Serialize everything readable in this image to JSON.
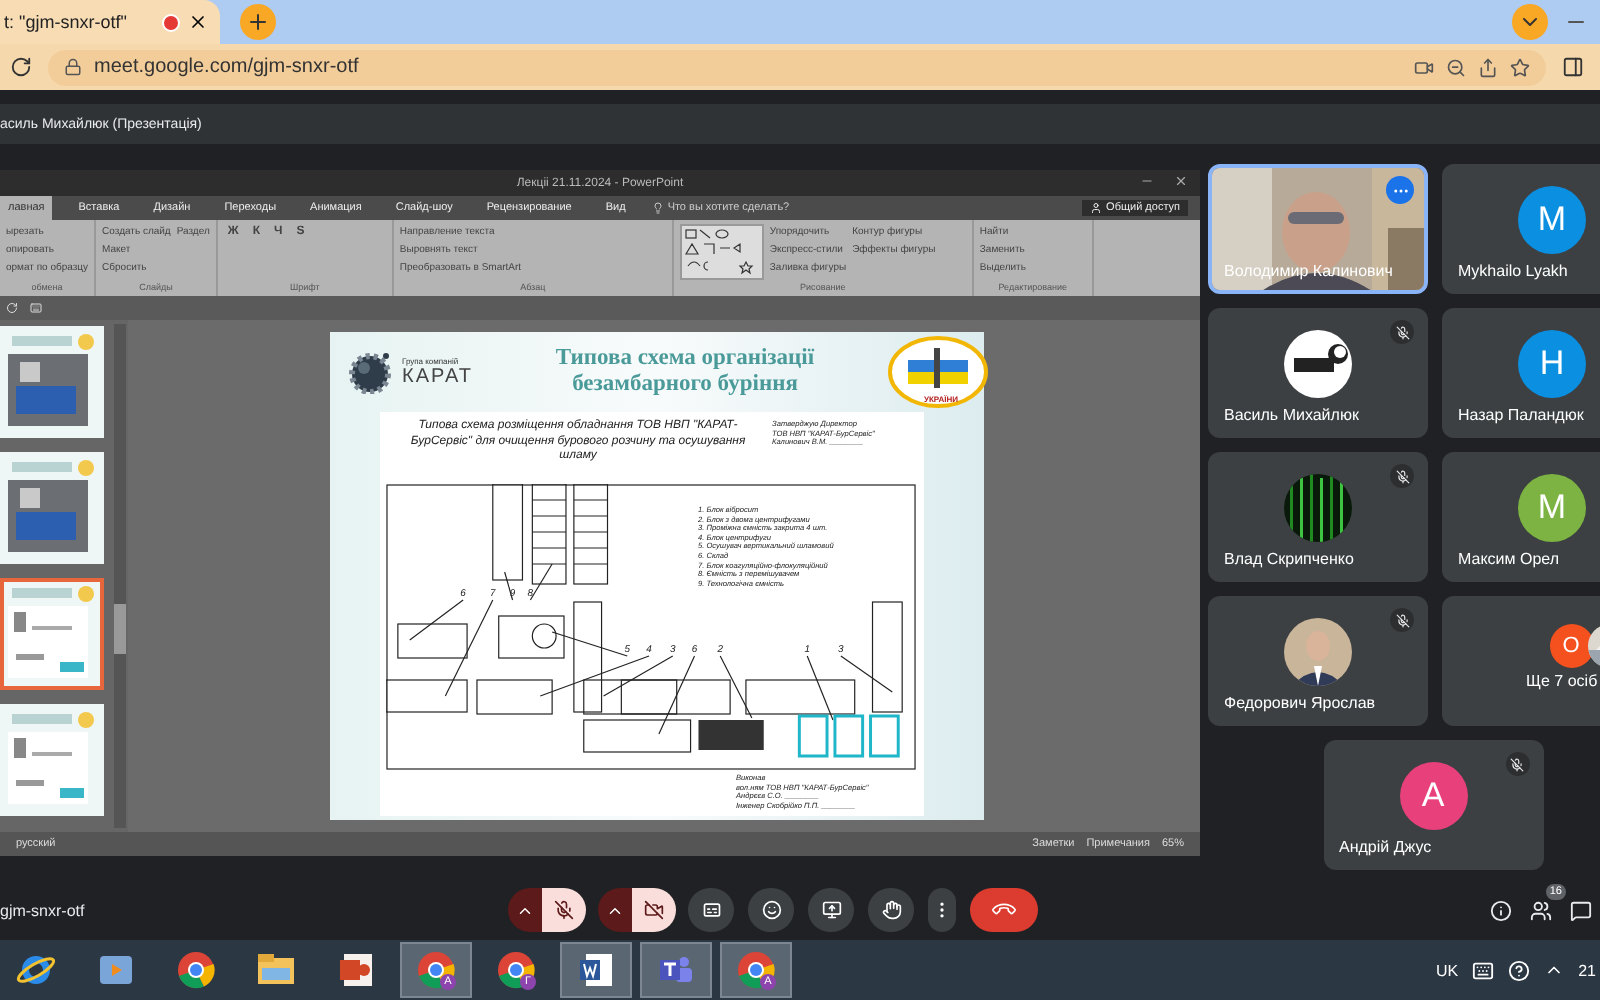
{
  "browser": {
    "tab_title": "t: \"gjm-snxr-otf\"",
    "url": "meet.google.com/gjm-snxr-otf"
  },
  "meet": {
    "presenter_label": "асиль Михайлюк (Презентація)",
    "meeting_code": "gjm-snxr-otf",
    "participant_count": "16",
    "mic_on": false,
    "camera_on": false
  },
  "presentation": {
    "window_title": "Лекціі 21.11.2024 - PowerPoint",
    "ribbon_tabs": [
      {
        "label": "лавная",
        "selected": true
      },
      {
        "label": "Вставка",
        "selected": false
      },
      {
        "label": "Дизайн",
        "selected": false
      },
      {
        "label": "Переходы",
        "selected": false
      },
      {
        "label": "Анимация",
        "selected": false
      },
      {
        "label": "Слайд-шоу",
        "selected": false
      },
      {
        "label": "Рецензирование",
        "selected": false
      },
      {
        "label": "Вид",
        "selected": false
      }
    ],
    "tell_me": "Что вы хотите сделать?",
    "share": "Общий доступ",
    "groups": [
      {
        "label": "обмена",
        "commands": [
          "ырезать",
          "опировать",
          "ормат по образцу"
        ]
      },
      {
        "label": "Слайды",
        "commands": [
          "Создать слайд",
          "Макет",
          "Сбросить",
          "Раздел"
        ]
      },
      {
        "label": "Шрифт",
        "commands": [
          "Ж",
          "К",
          "Ч",
          "S"
        ]
      },
      {
        "label": "Абзац",
        "commands": [
          "Направление текста",
          "Выровнять текст",
          "Преобразовать в SmartArt"
        ]
      },
      {
        "label": "Рисование",
        "commands": [
          "Упорядочить",
          "Экспресс-стили",
          "Заливка фигуры",
          "Контур фигуры",
          "Эффекты фигуры"
        ]
      },
      {
        "label": "Редактирование",
        "commands": [
          "Найти",
          "Заменить",
          "Выделить"
        ]
      }
    ],
    "thumbnails": [
      {
        "selected": false
      },
      {
        "selected": false
      },
      {
        "selected": true
      },
      {
        "selected": false
      }
    ],
    "status": {
      "language": "русский",
      "notes": "Заметки",
      "comments": "Примечания",
      "zoom": "65%"
    },
    "slide": {
      "brand_small": "Група компаній",
      "brand": "КАРАТ",
      "title": "Типова схема організації безамбарного буріння",
      "badge": "УКРАЇНИ",
      "drawing_title": "Типова схема розміщення обладнання ТОВ НВП \"КАРАТ-БурСервіс\" для очищення бурового розчину та осушування шламу",
      "approval": [
        "Затверджую Директор",
        "ТОВ НВП \"КАРАТ-БурСервіс\"",
        "Калинович В.М. ________"
      ],
      "legend": [
        "1. Блок вібросит",
        "2. Блок з двома центрифугами",
        "3. Проміжна ємність закрита 4 шт.",
        "4. Блок центрифуги",
        "5. Осушувач вертикальний шламовий",
        "6. Склад",
        "7. Блок коагуляційно-флокуляційний",
        "8. Ємність з перемішувачем",
        "9. Технологічна ємність"
      ],
      "labels": [
        "6",
        "7",
        "9",
        "8",
        "5",
        "4",
        "3",
        "6",
        "2",
        "1",
        "3"
      ],
      "signature": [
        "Виконав",
        "вол.ням ТОВ НВП \"КАРАТ-БурСервіс\"",
        "Андрєєв С.О. ________",
        "Інженер Скобрійко П.П. ________"
      ]
    }
  },
  "participants": [
    {
      "name": "Володимир Калинович",
      "kind": "video",
      "highlighted": true,
      "muted": false
    },
    {
      "name": "Mykhailo Lyakh",
      "kind": "initial",
      "initial": "M",
      "color": "#0b8fe0",
      "highlighted": false,
      "muted": false
    },
    {
      "name": "Василь Михайлюк",
      "kind": "logo",
      "highlighted": false,
      "muted": true
    },
    {
      "name": "Назар Паландюк",
      "kind": "initial",
      "initial": "H",
      "color": "#0b8fe0",
      "highlighted": false,
      "muted": false
    },
    {
      "name": "Влад Скрипченко",
      "kind": "matrix",
      "highlighted": false,
      "muted": true
    },
    {
      "name": "Максим Орел",
      "kind": "initial",
      "initial": "M",
      "color": "#7cb342",
      "highlighted": false,
      "muted": false
    },
    {
      "name": "Федорович Ярослав",
      "highlighted": false,
      "muted": true
    },
    {
      "name": "Ще 7 осіб",
      "kind": "more",
      "initial": "O",
      "color": "#f4511e",
      "highlighted": false,
      "muted": false
    },
    {
      "name": "Андрій Джус",
      "kind": "initial",
      "initial": "A",
      "color": "#e8407a",
      "highlighted": false,
      "muted": true
    }
  ],
  "taskbar": {
    "apps": [
      {
        "kind": "ie",
        "active": false
      },
      {
        "kind": "media",
        "active": false
      },
      {
        "kind": "chrome",
        "active": false
      },
      {
        "kind": "explorer",
        "active": false
      },
      {
        "kind": "powerpoint",
        "active": false
      },
      {
        "kind": "chrome",
        "badge": "A",
        "active": true
      },
      {
        "kind": "chrome",
        "badge": "Г",
        "active": false
      },
      {
        "kind": "word",
        "active": true
      },
      {
        "kind": "teams",
        "active": true
      },
      {
        "kind": "chrome",
        "badge": "A",
        "active": true
      }
    ],
    "language": "UK",
    "clock": "21"
  }
}
